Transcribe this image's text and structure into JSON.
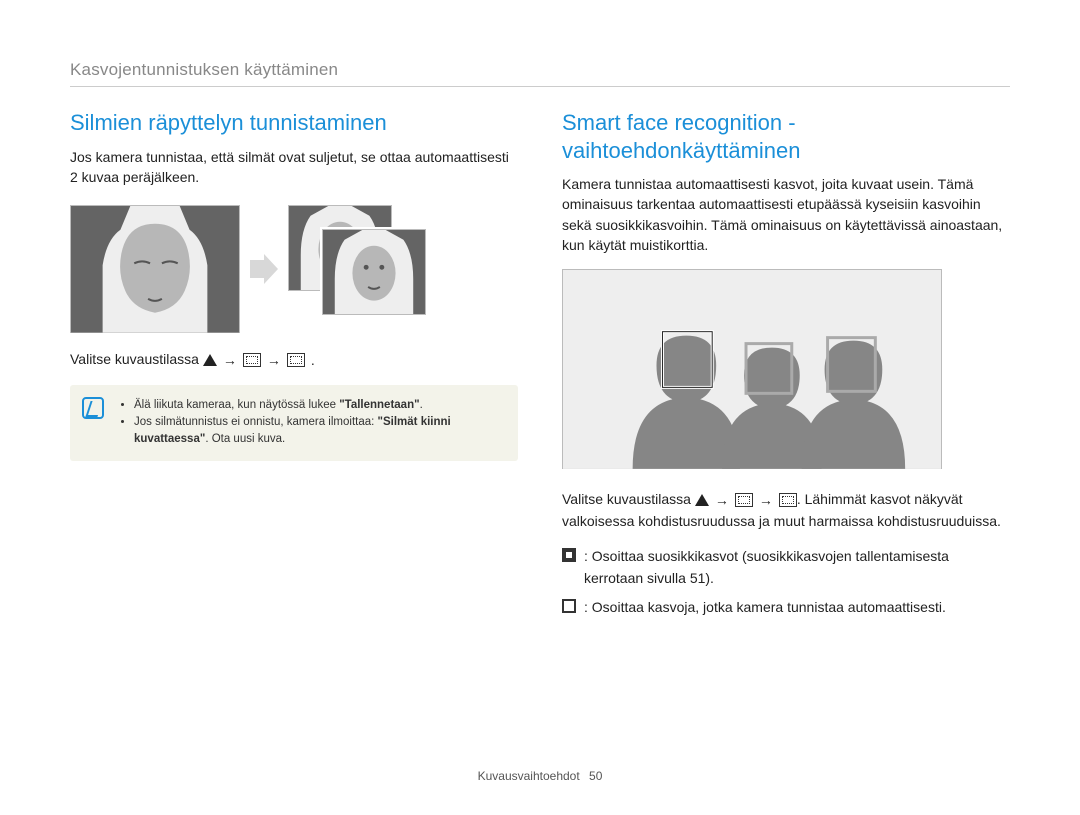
{
  "chapter": "Kasvojentunnistuksen käyttäminen",
  "left": {
    "heading": "Silmien räpyttelyn tunnistaminen",
    "intro": "Jos kamera tunnistaa, että silmät ovat suljetut, se ottaa automaattisesti 2 kuvaa peräjälkeen.",
    "instr_prefix": "Valitse kuvaustilassa ",
    "note1_a": "Älä liikuta kameraa, kun näytössä lukee ",
    "note1_b": "\"Tallennetaan\"",
    "note1_c": ".",
    "note2_a": "Jos silmätunnistus ei onnistu, kamera ilmoittaa: ",
    "note2_b": "\"Silmät kiinni kuvattaessa\"",
    "note2_c": ". Ota uusi kuva."
  },
  "right": {
    "heading": "Smart face recognition -vaihtoehdonkäyttäminen",
    "intro": "Kamera tunnistaa automaattisesti kasvot, joita kuvaat usein. Tämä ominaisuus tarkentaa automaattisesti etupäässä kyseisiin kasvoihin sekä suosikkikasvoihin. Tämä ominaisuus on käytettävissä ainoastaan, kun käytät muistikorttia.",
    "instr_prefix": "Valitse kuvaustilassa ",
    "instr_suffix": ". Lähimmät kasvot näkyvät valkoisessa kohdistusruudussa ja muut harmaissa kohdistusruuduissa.",
    "bullet1": ": Osoittaa suosikkikasvot (suosikkikasvojen tallentamisesta kerrotaan sivulla 51).",
    "bullet2": ": Osoittaa kasvoja, jotka kamera tunnistaa automaattisesti."
  },
  "footer": {
    "section": "Kuvausvaihtoehdot",
    "page": "50"
  }
}
